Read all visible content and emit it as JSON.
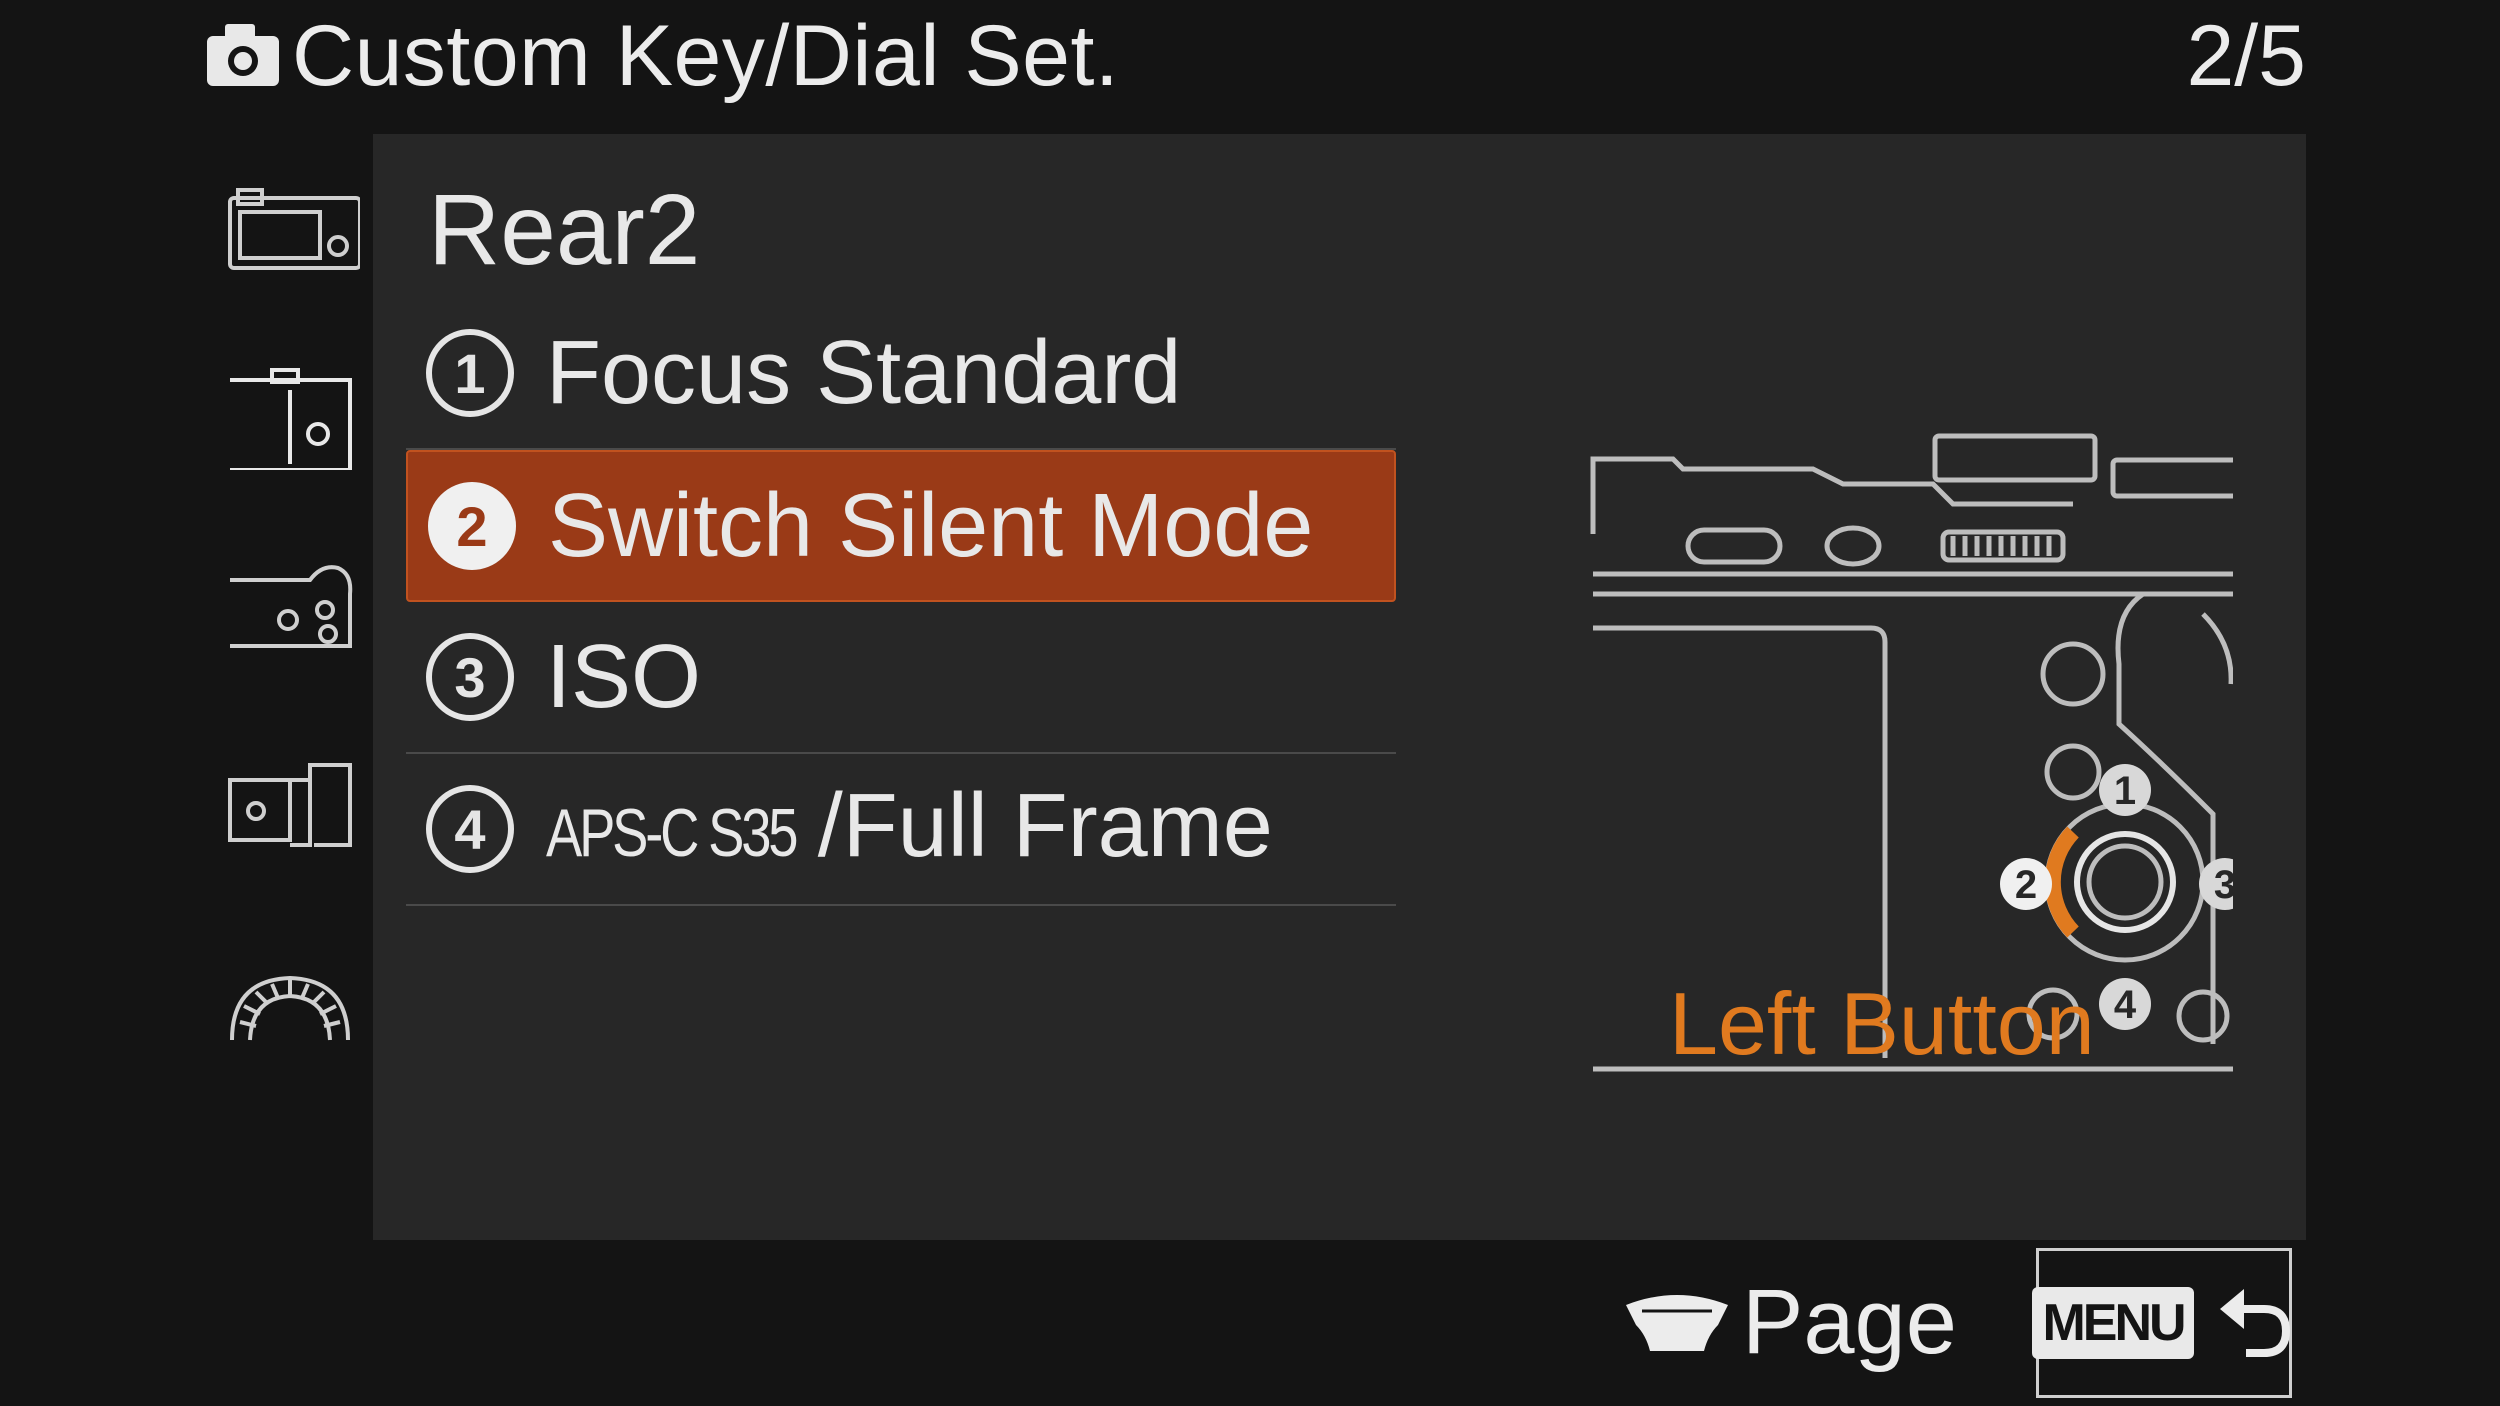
{
  "header": {
    "icon": "camera-icon",
    "title": "Custom Key/Dial Set.",
    "page_indicator": "2/5"
  },
  "sidebar": {
    "tabs": [
      {
        "icon": "camera-top-rear-icon",
        "selected": false
      },
      {
        "icon": "camera-rear-right-icon",
        "selected": true
      },
      {
        "icon": "camera-lens-side-icon",
        "selected": false
      },
      {
        "icon": "camera-front-grip-icon",
        "selected": false
      },
      {
        "icon": "dial-icon",
        "selected": false
      }
    ]
  },
  "panel": {
    "section_title": "Rear2",
    "items": [
      {
        "number": "1",
        "label": "Focus Standard",
        "selected": false
      },
      {
        "number": "2",
        "label": "Switch Silent Mode",
        "selected": true
      },
      {
        "number": "3",
        "label": "ISO",
        "selected": false
      },
      {
        "number": "4",
        "label_prefix": "APS-C S35",
        "label": "/Full Frame",
        "selected": false
      }
    ],
    "diagram": {
      "labels": [
        "1",
        "2",
        "3",
        "4"
      ],
      "highlighted": "2"
    },
    "function_name": "Left Button"
  },
  "footer": {
    "page_icon": "wheel-icon",
    "page_label": "Page",
    "menu_key": "MENU",
    "back_icon": "back-arrow-icon"
  },
  "colors": {
    "background": "#141414",
    "panel": "#272727",
    "selected_row": "#9a3a17",
    "accent_orange": "#e07a1f",
    "text": "#e8e8e8"
  }
}
